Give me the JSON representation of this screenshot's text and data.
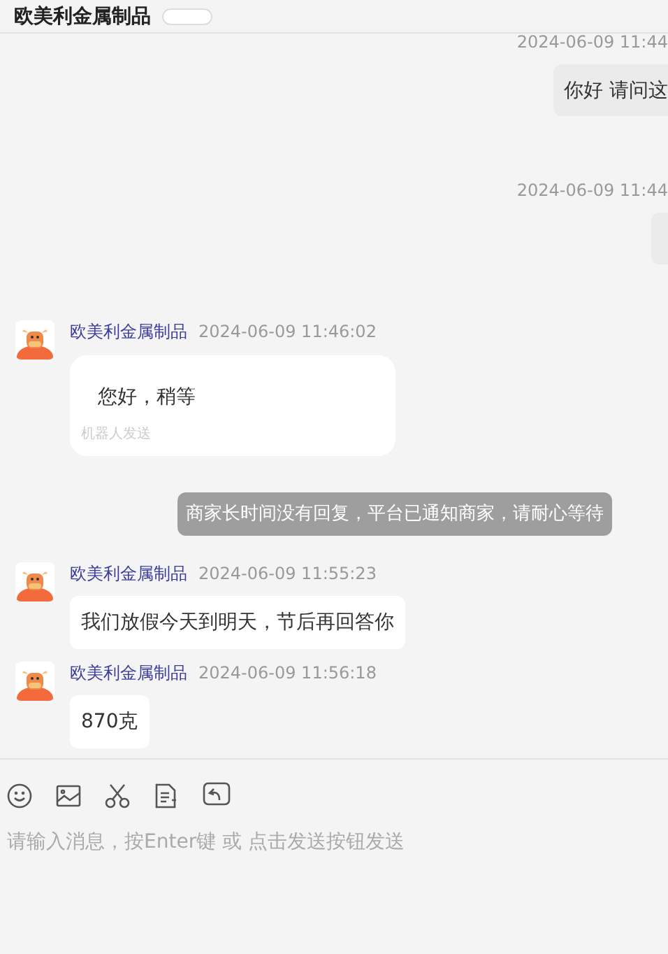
{
  "header": {
    "title": "欧美利金属制品"
  },
  "messages": [
    {
      "kind": "outgoing",
      "time": "2024-06-09 11:44",
      "text": "你好 请问这"
    },
    {
      "kind": "outgoing",
      "time": "2024-06-09 11:44"
    },
    {
      "kind": "incoming",
      "sender": "欧美利金属制品",
      "time": "2024-06-09 11:46:02",
      "text": "您好，稍等",
      "note": "机器人发送"
    },
    {
      "kind": "system",
      "text": "商家长时间没有回复，平台已通知商家，请耐心等待"
    },
    {
      "kind": "incoming",
      "sender": "欧美利金属制品",
      "time": "2024-06-09 11:55:23",
      "text": "我们放假今天到明天，节后再回答你"
    },
    {
      "kind": "incoming",
      "sender": "欧美利金属制品",
      "time": "2024-06-09 11:56:18",
      "text": "870克"
    }
  ],
  "composer": {
    "placeholder": "请输入消息，按Enter键 或 点击发送按钮发送"
  }
}
